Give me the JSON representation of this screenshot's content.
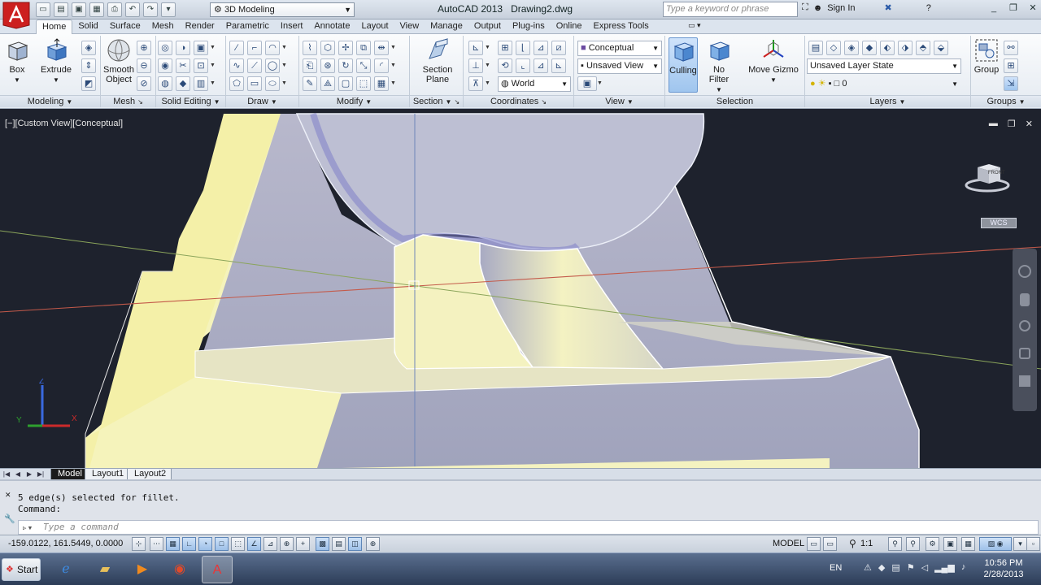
{
  "title": {
    "app": "AutoCAD 2013",
    "file": "Drawing2.dwg",
    "workspace": "3D Modeling",
    "search_placeholder": "Type a keyword or phrase",
    "sign_in": "Sign In"
  },
  "tabs": [
    "Home",
    "Solid",
    "Surface",
    "Mesh",
    "Render",
    "Parametric",
    "Insert",
    "Annotate",
    "Layout",
    "View",
    "Manage",
    "Output",
    "Plug-ins",
    "Online",
    "Express Tools"
  ],
  "active_tab": "Home",
  "ribbon": {
    "modeling": {
      "label": "Modeling",
      "box": "Box",
      "extrude": "Extrude"
    },
    "mesh": {
      "label": "Mesh",
      "smooth_object": "Smooth\nObject"
    },
    "solid_editing": {
      "label": "Solid Editing"
    },
    "draw": {
      "label": "Draw"
    },
    "modify": {
      "label": "Modify"
    },
    "section": {
      "label": "Section",
      "section_plane": "Section\nPlane"
    },
    "coordinates": {
      "label": "Coordinates",
      "ucs": "World"
    },
    "view": {
      "label": "View",
      "visual_style": "Conceptual",
      "view_name": "Unsaved View"
    },
    "selection": {
      "label": "Selection",
      "culling": "Culling",
      "no_filter": "No Filter",
      "move_gizmo": "Move Gizmo"
    },
    "layers": {
      "label": "Layers",
      "layer_state": "Unsaved Layer State",
      "current_layer": "0"
    },
    "groups": {
      "label": "Groups",
      "group": "Group"
    }
  },
  "viewport": {
    "label": "[−][Custom View][Conceptual]",
    "viewcube_face": "FRONT",
    "wcs": "WCS"
  },
  "layout_tabs": [
    "Model",
    "Layout1",
    "Layout2"
  ],
  "command": {
    "history": [
      "5 edge(s) selected for fillet.",
      "Command:"
    ],
    "placeholder": "Type a command"
  },
  "status": {
    "coords": "-159.0122, 161.5449, 0.0000",
    "model": "MODEL",
    "scale": "1:1"
  },
  "taskbar": {
    "start": "Start",
    "lang": "EN",
    "time": "10:56 PM",
    "date": "2/28/2013"
  },
  "colors": {
    "accent": "#cc1f1f",
    "viewport_bg": "#1e222d",
    "solid_face": "#f6f4c2",
    "solid_shadow": "#9d9fbb"
  }
}
